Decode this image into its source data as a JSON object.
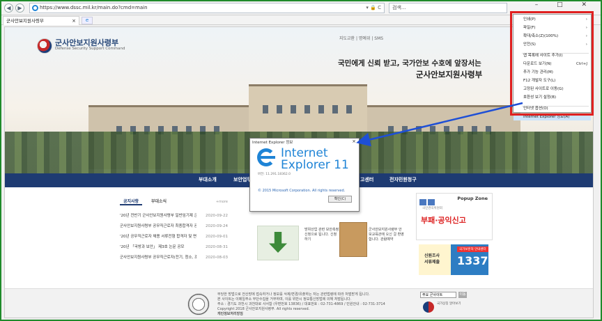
{
  "browser": {
    "url": "https://www.dssc.mil.kr/main.do?cmd=main",
    "address_tools": "▾ 🔒 C",
    "search_placeholder": "검색...",
    "tab_title": "군사안보지원사령부",
    "tab_close": "×",
    "window_controls": "– □ ✕",
    "command_icons": "⌕▾ ⌂ ☆ ⚙ ☺"
  },
  "site": {
    "logo_title": "군사안보지원사령부",
    "logo_subtitle": "Defense Security Support Command",
    "util_links": "지도교환 | 명예위 | SMS",
    "slogan_line1": "국민에게 신뢰 받고, 국가안보 수호에 앞장서는",
    "slogan_line2": "군사안보지원사령부",
    "menu": [
      "부대소개",
      "보안업무",
      "고센터",
      "전자민원청구"
    ]
  },
  "notice": {
    "tabs": [
      "공지사항",
      "부대소식"
    ],
    "more": "+more",
    "items": [
      {
        "title": "'20년 전반기 군사안보지원사령부 일반임기제 군무원...",
        "date": "2020-09-22"
      },
      {
        "title": "군사안보지원사령부 공무직근로자 최종합격자 공고",
        "date": "2020-09-24"
      },
      {
        "title": "'20년 공무직근로자 채용 서류전형 합격자 및 면접...",
        "date": "2020-09-01"
      },
      {
        "title": "'20년 「국방과 보안」 제3호 논문 공모",
        "date": "2020-08-31"
      },
      {
        "title": "군사안보지원사령부 공무직근로자(전기, 청소, 조리)...",
        "date": "2020-08-03"
      }
    ]
  },
  "banners": {
    "left_text": "방위산업 관련 보안측정 신청으로 됩니다. 신청하기",
    "right_text": "군사안보지원사령부 안보교육관에 오신 걸 환영합니다. 관람예약"
  },
  "popup_zone": {
    "title": "Popup Zone",
    "slogan": "부패·공익신고",
    "subtitle": "국민권익위원회"
  },
  "survey": {
    "label_line1": "신원조사",
    "label_line2": "서류제출",
    "tag": "국가보훈처 안내센터",
    "number": "1337"
  },
  "footer": {
    "line1": "부당한 방법으로 전산망에 접속하거나 정보를 삭제/변경/유출하는 자는 관련법령에 따라 처벌받게 됩니다.",
    "line2": "본 사이트는 이메일주소 무단수집을 거부하며, 이를 위반시 정보통신망법에 의해 처벌됩니다.",
    "line3": "주소 : 경기도 과천시 과천대로 사서함 (우편번호 13836) / 대표번호 : 02-731-4869 / 민원안내 : 02-731-3714",
    "line4": "Copyright 2018 군사안보지원사령부. All rights reserved.",
    "line5": "개인정보처리방침",
    "select_value": "주요 군사이트",
    "go_label": "이동",
    "mark_text": "국가상징 알아보기"
  },
  "about_dialog": {
    "title": "Internet Explorer 정보",
    "close": "×",
    "name_line1": "Internet",
    "name_line2": "Explorer 11",
    "version": "버전: 11.291.18362.0",
    "copyright": "© 2015 Microsoft Corporation. All rights reserved.",
    "ok": "확인(C)"
  },
  "tools_menu": {
    "items": [
      {
        "label": "인쇄(P)",
        "shortcut": "›"
      },
      {
        "label": "파일(F)",
        "shortcut": "›"
      },
      {
        "label": "확대/축소(Z)(100%)",
        "shortcut": "›"
      },
      {
        "label": "안전(S)",
        "shortcut": "›"
      },
      {
        "label": "앱 목록에 사이트 추가(I)",
        "shortcut": ""
      },
      {
        "label": "다운로드 보기(N)",
        "shortcut": "Ctrl+J"
      },
      {
        "label": "추가 기능 관리(M)",
        "shortcut": ""
      },
      {
        "label": "F12 개발자 도구(L)",
        "shortcut": ""
      },
      {
        "label": "고정된 사이트로 이동(G)",
        "shortcut": ""
      },
      {
        "label": "호환성 보기 설정(B)",
        "shortcut": ""
      },
      {
        "label": "인터넷 옵션(O)",
        "shortcut": ""
      },
      {
        "label": "Internet Explorer 정보(A)",
        "shortcut": ""
      }
    ],
    "selected_index": 11
  },
  "annotation_colors": {
    "highlight_box": "#e02020",
    "arrow": "#1e4fd6",
    "frame": "#1f8a2a"
  }
}
